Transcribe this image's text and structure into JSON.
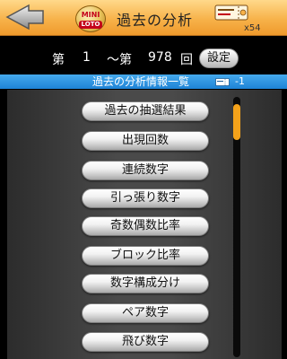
{
  "header": {
    "title": "過去の分析",
    "logo_line1": "MINI",
    "logo_line2": "LOTO",
    "ticket_count": "x54",
    "back_icon": "back-arrow-icon",
    "ticket_icon": "ticket-icon"
  },
  "range": {
    "prefix_from": "第",
    "from_value": "1",
    "separator": "～第",
    "to_value": "978",
    "suffix": "回",
    "settings_label": "設定"
  },
  "section": {
    "title": "過去の分析情報一覧",
    "ticket_icon": "ticket-icon",
    "ticket_delta": "-1"
  },
  "menu": {
    "items": [
      "過去の抽選結果",
      "出現回数",
      "連続数字",
      "引っ張り数字",
      "奇数偶数比率",
      "ブロック比率",
      "数字構成分け",
      "ペア数字",
      "飛び数字"
    ]
  },
  "colors": {
    "header_orange": "#f7b24a",
    "section_blue": "#2b90dd",
    "scroll_orange": "#f4a21a",
    "logo_red": "#c4001a"
  }
}
